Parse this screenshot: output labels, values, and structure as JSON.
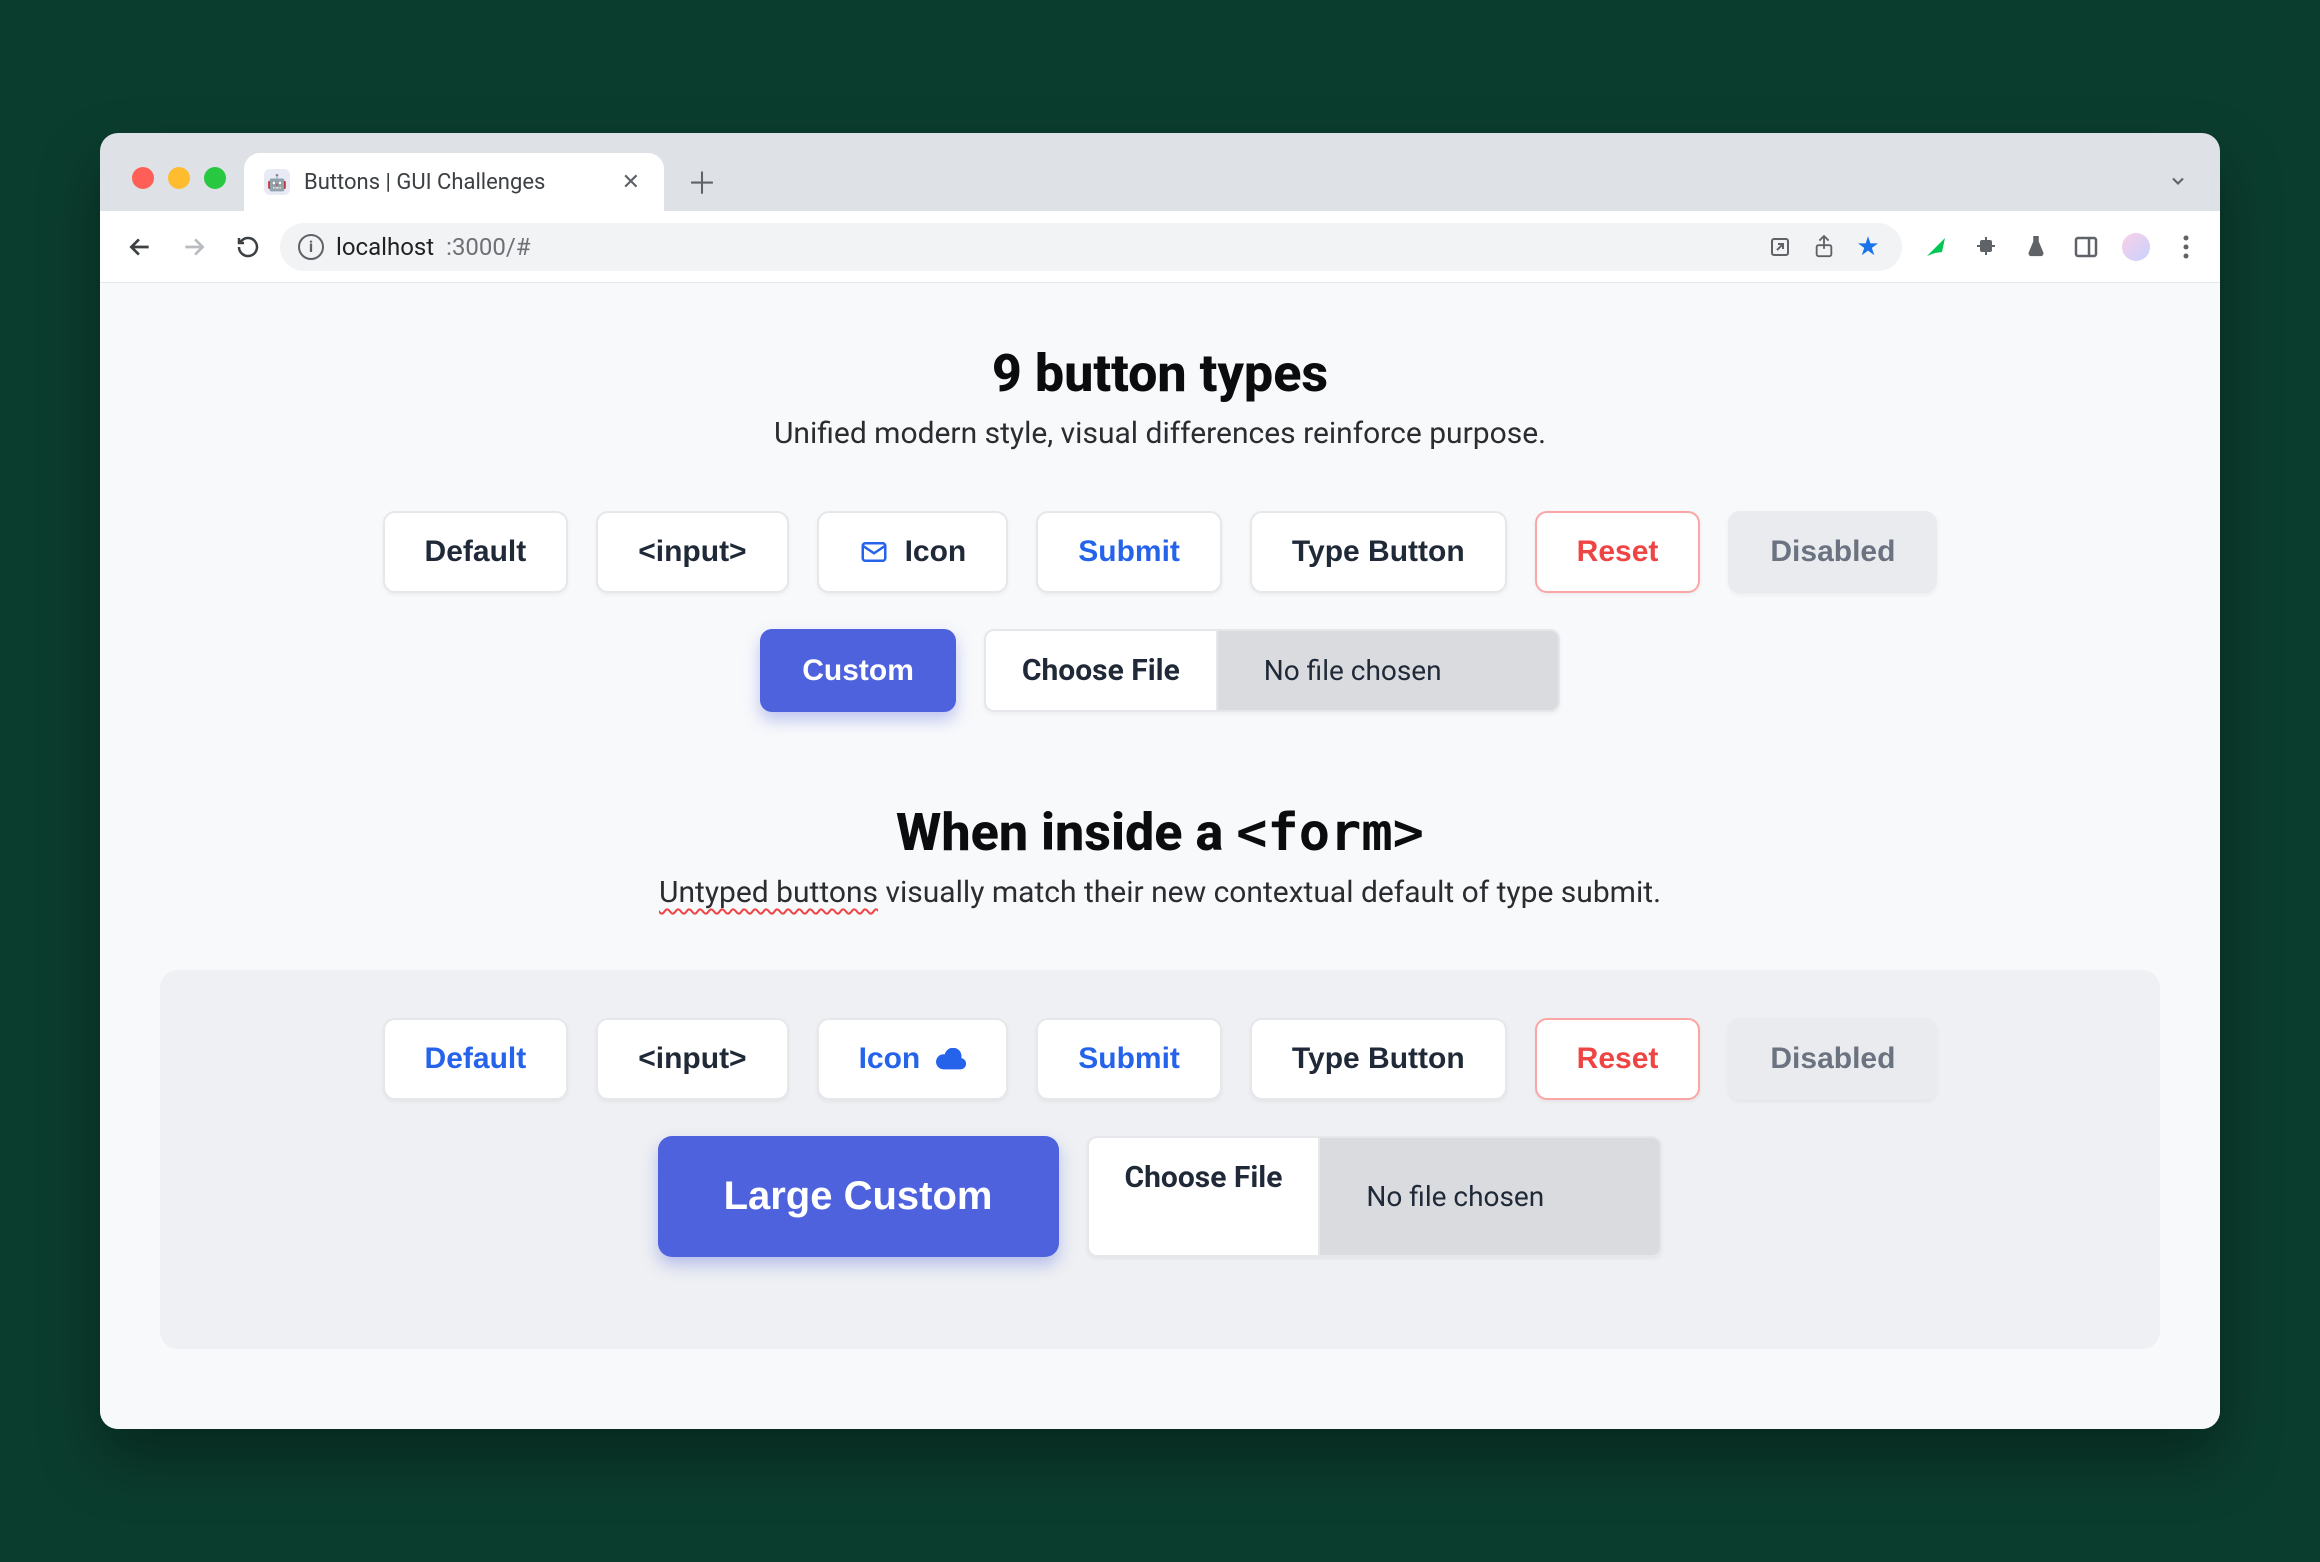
{
  "browser": {
    "tab_title": "Buttons | GUI Challenges",
    "url_host": "localhost",
    "url_port_path": ":3000/#"
  },
  "section1": {
    "heading": "9 button types",
    "subtitle": "Unified modern style, visual differences reinforce purpose.",
    "buttons": {
      "default": "Default",
      "input": "<input>",
      "icon": "Icon",
      "submit": "Submit",
      "type_button": "Type Button",
      "reset": "Reset",
      "disabled": "Disabled",
      "custom": "Custom",
      "choose_file": "Choose File",
      "file_status": "No file chosen"
    }
  },
  "section2": {
    "heading_prefix": "When inside a ",
    "heading_code": "<form>",
    "subtitle_underlined": "Untyped buttons",
    "subtitle_rest": " visually match their new contextual default of type submit.",
    "buttons": {
      "default": "Default",
      "input": "<input>",
      "icon": "Icon",
      "submit": "Submit",
      "type_button": "Type Button",
      "reset": "Reset",
      "disabled": "Disabled",
      "custom": "Large Custom",
      "choose_file": "Choose File",
      "file_status": "No file chosen"
    }
  }
}
